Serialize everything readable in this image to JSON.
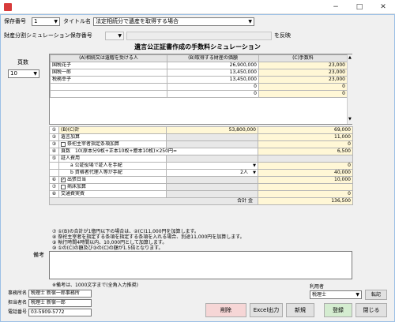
{
  "window": {
    "min_icon": "−",
    "max_icon": "□",
    "close_icon": "✕"
  },
  "header": {
    "save_no_label": "保存番号",
    "save_no_value": "1",
    "title_label": "タイトル名",
    "title_value": "法定相続分で遺産を取得する場合",
    "sim_label": "財産分割シミュレーション保存番号",
    "reflect_label": "を反映"
  },
  "page_title": "遺言公正証書作成の手数料シミュレーション",
  "pages": {
    "label": "頁数",
    "value": "10"
  },
  "table": {
    "headers": [
      "(A)相続又は遺贈を受ける人",
      "(B)取得する財産の価額",
      "(C)手数料"
    ],
    "heirs": [
      {
        "name": "国税花子",
        "value": "26,900,000",
        "fee": "23,000"
      },
      {
        "name": "国税一郎",
        "value": "13,450,000",
        "fee": "23,000"
      },
      {
        "name": "税務幸子",
        "value": "13,450,000",
        "fee": "23,000"
      },
      {
        "name": "",
        "value": "0",
        "fee": "0"
      },
      {
        "name": "",
        "value": "0",
        "fee": "0"
      }
    ],
    "rows": {
      "r1_no": "①",
      "r1_label": "(B)(C)計",
      "r1_value": "53,800,000",
      "r1_fee": "69,000",
      "r2_no": "②",
      "r2_label": "遺言加算",
      "r2_fee": "11,000",
      "r3_no": "③",
      "r3_label": "祭祀主宰者指定条項加算",
      "r3_fee": "0",
      "r4_no": "④",
      "r4_label": "頁数　10(原本分9枚+正本10枚+謄本10枚)×250円=",
      "r4_fee": "6,500",
      "r5_no": "⑤",
      "r5_label": "証人費用",
      "r5a_label": "a 公証役場で証人を手配",
      "r5a_fee": "0",
      "r5b_label": "b 資格者代理人等が手配",
      "r5b_qty": "2人",
      "r5b_fee": "40,000",
      "r6_no": "⑥",
      "r6_label": "出張日当",
      "r6_fee": "10,000",
      "r7_no": "⑦",
      "r7_label": "病床加算",
      "r7_fee": "",
      "r8_no": "⑧",
      "r8_label": "交通費実費",
      "r8_fee": "0",
      "total_label": "合計 金",
      "total_value": "136,500"
    }
  },
  "notes": [
    "⑦ ①(B)の合計が1億円以下の場合は、②(C)11,000円を加算します。",
    "⑧ 祭祀主宰者を指定する条項を指定する条項を入れる場合、別途11,000円を加算します。",
    "⑨ 執行時間4時間以内、10,000円として加算します。",
    "⑩ ①の(C)の額及び③の(C)の額が1.5倍となります。"
  ],
  "memo": {
    "label": "備考",
    "hint": "※備考は、1000文字まで(全角入力推奨)"
  },
  "footer": {
    "office_label": "事務所名",
    "office_value": "税理士 新宿一郎事務所",
    "person_label": "担当者名",
    "person_value": "税理士 新宿一郎",
    "phone_label": "電話番号",
    "phone_value": "03-5909-5772",
    "user_label": "利用者",
    "user_value": "税理士",
    "transfer_label": "転記"
  },
  "buttons": {
    "delete": "削除",
    "excel": "Excel出力",
    "new": "新規",
    "register": "登録",
    "close": "閉じる"
  }
}
